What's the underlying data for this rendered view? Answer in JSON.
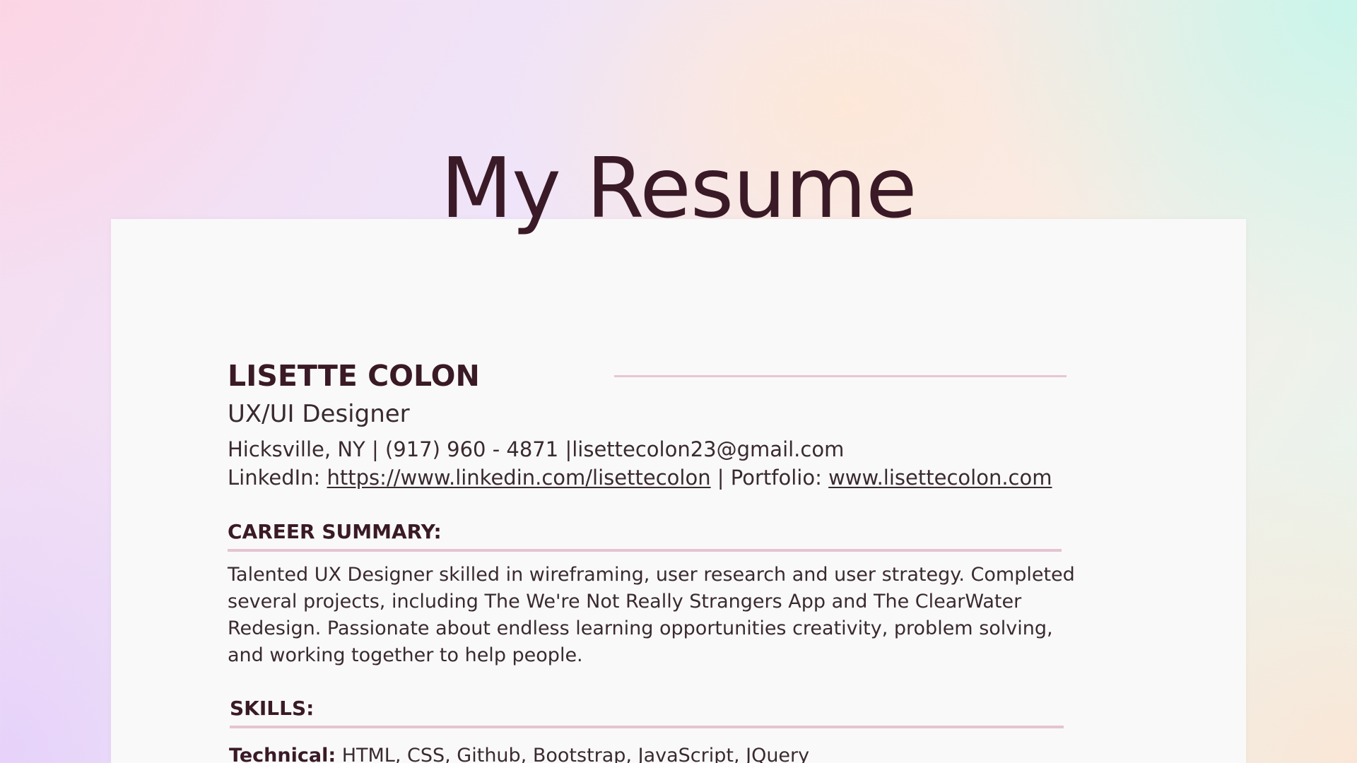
{
  "page": {
    "heading": "My Resume"
  },
  "resume": {
    "name": "LISETTE COLON",
    "role": "UX/UI Designer",
    "contact": {
      "location": "Hicksville, NY",
      "separator": "|",
      "phone": "(917) 960 - 4871",
      "email": "lisettecolon23@gmail.com",
      "linkedin_label": "LinkedIn:",
      "linkedin_url": "https://www.linkedin.com/lisettecolon",
      "portfolio_label": "Portfolio:",
      "portfolio_url": "www.lisettecolon.com"
    },
    "sections": {
      "summary_title": "CAREER SUMMARY:",
      "summary_text": "Talented UX Designer skilled in wireframing, user research and user strategy. Completed several projects, including The We're Not Really Strangers App and The ClearWater Redesign. Passionate about endless learning opportunities creativity, problem solving, and working together to help people.",
      "skills_title": "SKILLS:",
      "skills_technical_label": "Technical:",
      "skills_technical_value": "HTML, CSS, Github, Bootstrap, JavaScript, JQuery"
    }
  },
  "colors": {
    "heading": "#3a1a26",
    "rule": "#e6c4d2",
    "sheet": "#f9f9f9"
  }
}
